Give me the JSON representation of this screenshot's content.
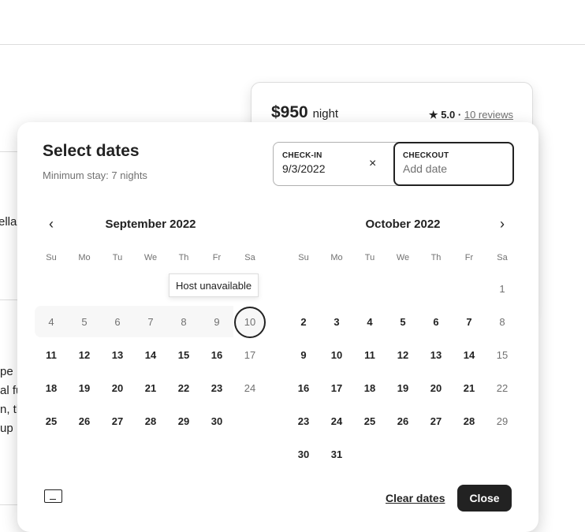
{
  "background": {
    "fragments": [
      "ella",
      "pe",
      "al fu",
      "n, th",
      "up"
    ]
  },
  "booking_card": {
    "price": "$950",
    "unit": "night",
    "rating": "5.0",
    "separator": "·",
    "reviews": "10 reviews"
  },
  "picker": {
    "title": "Select dates",
    "subtitle": "Minimum stay: 7 nights",
    "checkin": {
      "label": "CHECK-IN",
      "value": "9/3/2022"
    },
    "checkout": {
      "label": "CHECKOUT",
      "placeholder": "Add date"
    },
    "clear_icon": "×",
    "tooltip": "Host unavailable",
    "weekdays": [
      "Su",
      "Mo",
      "Tu",
      "We",
      "Th",
      "Fr",
      "Sa"
    ],
    "months": [
      {
        "title": "September 2022",
        "weeks": [
          [
            "",
            "",
            "",
            "",
            "",
            "",
            ""
          ],
          [
            "4",
            "5",
            "6",
            "7",
            "8",
            "9",
            "10"
          ],
          [
            "11",
            "12",
            "13",
            "14",
            "15",
            "16",
            "17"
          ],
          [
            "18",
            "19",
            "20",
            "21",
            "22",
            "23",
            "24"
          ],
          [
            "25",
            "26",
            "27",
            "28",
            "29",
            "30",
            ""
          ]
        ],
        "unavailable": [
          "4",
          "5",
          "6",
          "7",
          "8",
          "9",
          "10",
          "17",
          "24"
        ],
        "focused": "10"
      },
      {
        "title": "October 2022",
        "weeks": [
          [
            "",
            "",
            "",
            "",
            "",
            "",
            "1"
          ],
          [
            "2",
            "3",
            "4",
            "5",
            "6",
            "7",
            "8"
          ],
          [
            "9",
            "10",
            "11",
            "12",
            "13",
            "14",
            "15"
          ],
          [
            "16",
            "17",
            "18",
            "19",
            "20",
            "21",
            "22"
          ],
          [
            "23",
            "24",
            "25",
            "26",
            "27",
            "28",
            "29"
          ],
          [
            "30",
            "31",
            "",
            "",
            "",
            "",
            ""
          ]
        ],
        "unavailable": [
          "1",
          "8",
          "15",
          "22",
          "29"
        ],
        "focused": ""
      }
    ],
    "clear_label": "Clear dates",
    "close_label": "Close",
    "prev_icon": "‹",
    "next_icon": "›"
  }
}
